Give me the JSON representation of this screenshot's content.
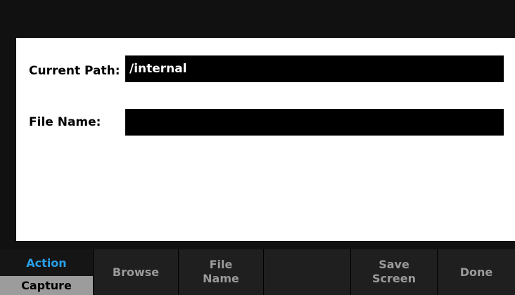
{
  "dialog": {
    "current_path_label": "Current Path:",
    "current_path_value": "/internal",
    "file_name_label": "File Name:",
    "file_name_value": ""
  },
  "softkeys": {
    "action_title": "Action",
    "action_value": "Capture",
    "browse": "Browse",
    "file_name_line1": "File",
    "file_name_line2": "Name",
    "empty": "",
    "save_screen_line1": "Save",
    "save_screen_line2": "Screen",
    "done": "Done"
  },
  "colors": {
    "accent": "#2a9fe8",
    "softkey_bg": "#1f1f1f",
    "softkey_text": "#9a9a9a",
    "selected_value_bg": "#9c9c9c"
  }
}
